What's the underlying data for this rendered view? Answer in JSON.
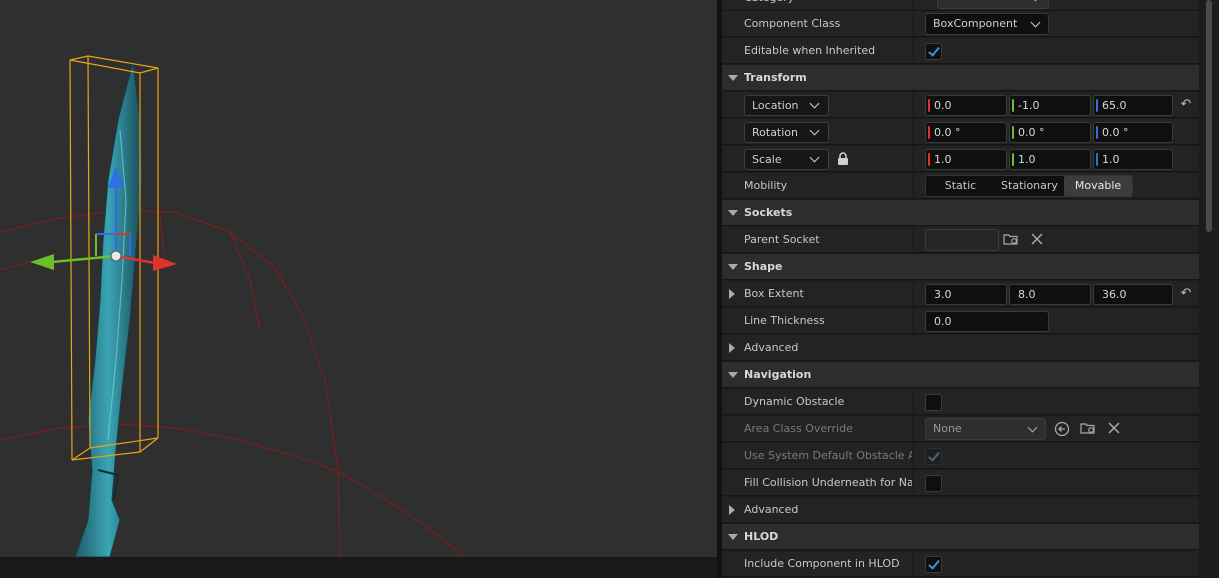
{
  "details": {
    "rows": {
      "category": {
        "label": "Category"
      },
      "component_class": {
        "label": "Component Class",
        "value": "BoxComponent"
      },
      "editable_when_inherited": {
        "label": "Editable when Inherited",
        "checked": true
      },
      "transform": {
        "label": "Transform"
      },
      "location": {
        "mode": "Location",
        "x": "0.0",
        "y": "-1.0",
        "z": "65.0"
      },
      "rotation": {
        "mode": "Rotation",
        "x": "0.0 °",
        "y": "0.0 °",
        "z": "0.0 °"
      },
      "scale": {
        "mode": "Scale",
        "x": "1.0",
        "y": "1.0",
        "z": "1.0"
      },
      "mobility": {
        "label": "Mobility",
        "options": [
          "Static",
          "Stationary",
          "Movable"
        ],
        "selected": "Movable"
      },
      "sockets": {
        "label": "Sockets"
      },
      "parent_socket": {
        "label": "Parent Socket",
        "value": ""
      },
      "shape": {
        "label": "Shape"
      },
      "box_extent": {
        "label": "Box Extent",
        "x": "3.0",
        "y": "8.0",
        "z": "36.0"
      },
      "line_thickness": {
        "label": "Line Thickness",
        "value": "0.0"
      },
      "advanced_shape": {
        "label": "Advanced"
      },
      "navigation": {
        "label": "Navigation"
      },
      "dynamic_obstacle": {
        "label": "Dynamic Obstacle",
        "checked": false
      },
      "area_class_override": {
        "label": "Area Class Override",
        "value": "None"
      },
      "use_system_default": {
        "label": "Use System Default Obstacle A...",
        "checked": true
      },
      "fill_collision": {
        "label": "Fill Collision Underneath for Na...",
        "checked": false
      },
      "advanced_nav": {
        "label": "Advanced"
      },
      "hlod": {
        "label": "HLOD"
      },
      "include_in_hlod": {
        "label": "Include Component in HLOD",
        "checked": true
      }
    }
  },
  "colors": {
    "axis_x": "#e0322f",
    "axis_y": "#6cbf2a",
    "axis_z": "#2f6fe0",
    "check_blue": "#3d8fe0",
    "bounds_orange": "#e8a317",
    "sphere_red": "#8b1a1a"
  },
  "icons": {
    "lock": "lock-icon",
    "reset": "reset-arrow-icon",
    "browse": "browse-folder-icon",
    "clear": "clear-x-icon",
    "use_selected": "use-selected-arrow-icon"
  }
}
